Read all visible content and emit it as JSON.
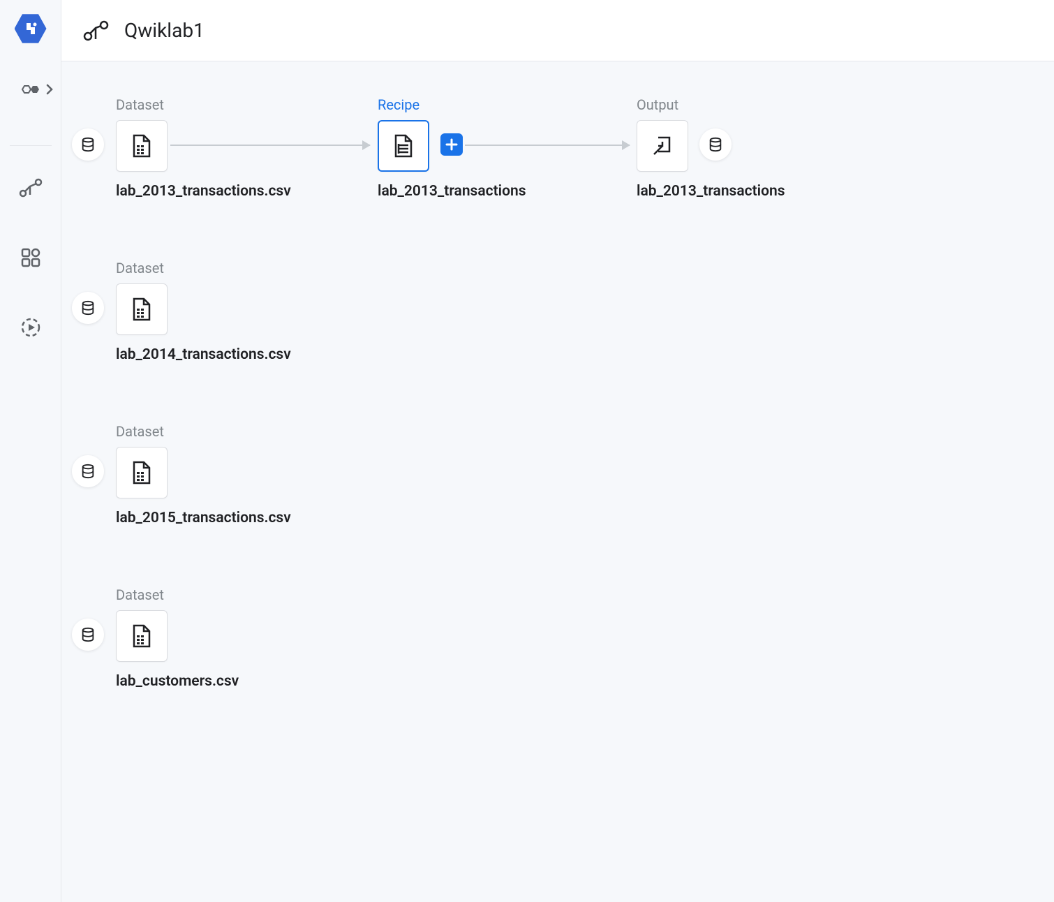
{
  "header": {
    "title": "Qwiklab1"
  },
  "labels": {
    "dataset": "Dataset",
    "recipe": "Recipe",
    "output": "Output"
  },
  "row1": {
    "dataset_name": "lab_2013_transactions.csv",
    "recipe_name": "lab_2013_transactions",
    "output_name": "lab_2013_transactions"
  },
  "datasets": [
    {
      "name": "lab_2014_transactions.csv"
    },
    {
      "name": "lab_2015_transactions.csv"
    },
    {
      "name": "lab_customers.csv"
    }
  ]
}
